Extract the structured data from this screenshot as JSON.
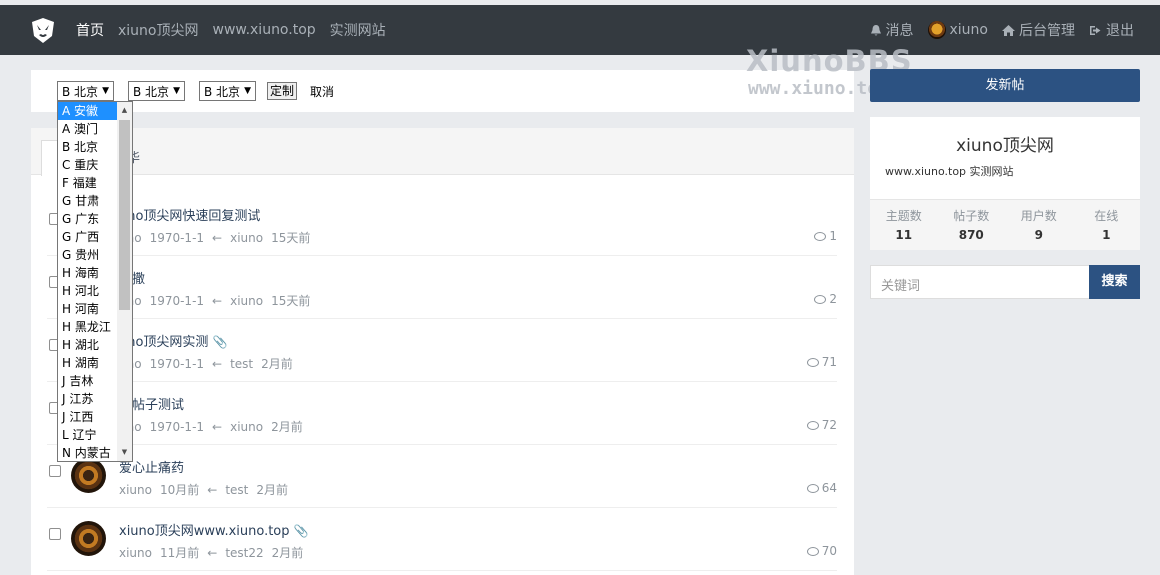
{
  "nav": {
    "items": [
      "首页",
      "xiuno顶尖网",
      "www.xiuno.top",
      "实测网站"
    ],
    "message": "消息",
    "user": "xiuno",
    "admin": "后台管理",
    "logout": "退出"
  },
  "watermark": {
    "line1": "XiunoBBS",
    "line2": "www.xiuno.top"
  },
  "filter": {
    "select1": "B 北京",
    "select2": "B 北京",
    "select3": "B 北京",
    "custom_label": "定制",
    "cancel_label": "取消"
  },
  "dropdown": {
    "options": [
      "A 安徽",
      "A 澳门",
      "B 北京",
      "C 重庆",
      "F 福建",
      "G 甘肃",
      "G 广东",
      "G 广西",
      "G 贵州",
      "H 海南",
      "H 河北",
      "H 河南",
      "H 黑龙江",
      "H 湖北",
      "H 湖南",
      "J 吉林",
      "J 江苏",
      "J 江西",
      "L 辽宁",
      "N 内蒙古"
    ],
    "selected_index": 0
  },
  "tabs": {
    "tab2_partial": "华"
  },
  "threads": [
    {
      "title_partial": "uno顶尖网快速回复测试",
      "meta": [
        "uno",
        "1970-1-1",
        "←",
        "xiuno",
        "15天前"
      ],
      "replies": "1",
      "attach": false
    },
    {
      "title_partial": "的撒",
      "meta": [
        "uno",
        "1970-1-1",
        "←",
        "xiuno",
        "15天前"
      ],
      "replies": "2",
      "attach": false
    },
    {
      "title_partial": "uno顶尖网实测",
      "meta": [
        "uno",
        "1970-1-1",
        "←",
        "test",
        "2月前"
      ],
      "replies": "71",
      "attach": true
    },
    {
      "title_partial": "长帖子测试",
      "meta": [
        "uno",
        "1970-1-1",
        "←",
        "xiuno",
        "2月前"
      ],
      "replies": "72",
      "attach": false
    },
    {
      "title_partial": "爱心止痛药",
      "meta": [
        "xiuno",
        "10月前",
        "←",
        "test",
        "2月前"
      ],
      "replies": "64",
      "attach": false
    },
    {
      "title_partial": "xiuno顶尖网www.xiuno.top",
      "meta": [
        "xiuno",
        "11月前",
        "←",
        "test22",
        "2月前"
      ],
      "replies": "70",
      "attach": true
    }
  ],
  "sidebar": {
    "new_thread": "发新帖",
    "site_name": "xiuno顶尖网",
    "site_desc": "www.xiuno.top 实测网站",
    "stats": [
      {
        "label": "主题数",
        "value": "11"
      },
      {
        "label": "帖子数",
        "value": "870"
      },
      {
        "label": "用户数",
        "value": "9"
      },
      {
        "label": "在线",
        "value": "1"
      }
    ],
    "search_placeholder": "关键词",
    "search_button": "搜索"
  },
  "colors": {
    "nav_bg": "#343a40",
    "primary": "#2c5282",
    "page_bg": "#e9ebee",
    "dropdown_selected": "#1e90ff"
  }
}
